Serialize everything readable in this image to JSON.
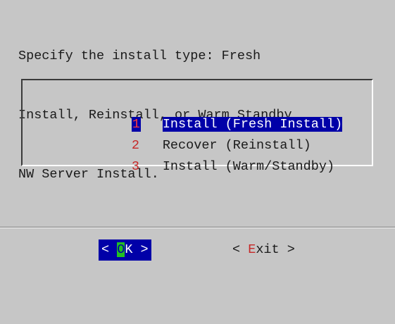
{
  "prompt": {
    "lines": [
      "Specify the install type: Fresh",
      "Install, Reinstall, or Warm Standby",
      "NW Server Install."
    ]
  },
  "menu": {
    "items": [
      {
        "key": "1",
        "label": "Install (Fresh Install)",
        "selected": true
      },
      {
        "key": "2",
        "label": "Recover (Reinstall)",
        "selected": false
      },
      {
        "key": "3",
        "label": "Install (Warm/Standby)",
        "selected": false
      }
    ]
  },
  "buttons": {
    "ok": {
      "open": "< ",
      "hotkey": "O",
      "rest": "K >"
    },
    "exit": {
      "open": "< ",
      "hotkey": "E",
      "rest": "xit >"
    }
  },
  "colors": {
    "background": "#c6c6c6",
    "selection": "#0000a8",
    "hotkey": "#c62828",
    "ok_hotkey_bg": "#22c022"
  }
}
